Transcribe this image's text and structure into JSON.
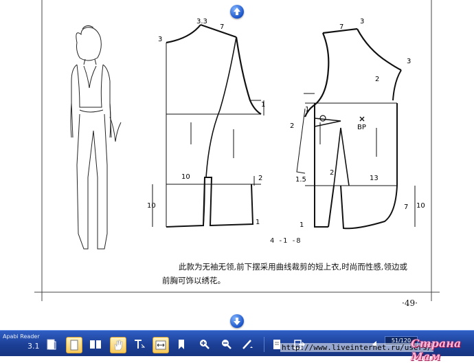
{
  "viewer": {
    "brand": "Apabi Reader",
    "version": "3.1",
    "page_field": "51/120",
    "url": "http://www.liveinternet.ru/users/",
    "watermark": "Страна Мам"
  },
  "page": {
    "figure_label": "4 -1 -8",
    "caption": "此款为无袖无领,前下摆采用曲线裁剪的短上衣,时尚而性感,领边或前胸可饰以绣花。",
    "page_number": "·49·"
  },
  "measurements": {
    "back_neck_width": "3.3",
    "back_shoulder": "7",
    "back_neck_depth": "3",
    "back_armhole": "1",
    "back_side": "10",
    "back_hem_side": "2",
    "back_hem_height": "10",
    "back_hem_end": "1",
    "front_shoulder": "7",
    "front_neck_width": "3",
    "front_neck_side": "3",
    "front_dart": "2",
    "front_side_left": "1",
    "front_bust_dart": "2",
    "bp_label": "BP",
    "front_waist_left": "1.5",
    "front_waist_dart": "2",
    "front_waist_right": "13",
    "front_hem_curve": "7",
    "front_hem_height": "10",
    "front_hem_end": "1"
  },
  "icons": [
    "arrow-up-icon",
    "arrow-down-icon",
    "page-icon",
    "single-page-icon",
    "two-page-icon",
    "hand-icon",
    "text-select-icon",
    "fit-width-icon",
    "bookmark-icon",
    "zoom-in-icon",
    "zoom-out-icon",
    "pen-icon",
    "note-icon",
    "exit-icon",
    "prev-icon",
    "next-icon"
  ]
}
